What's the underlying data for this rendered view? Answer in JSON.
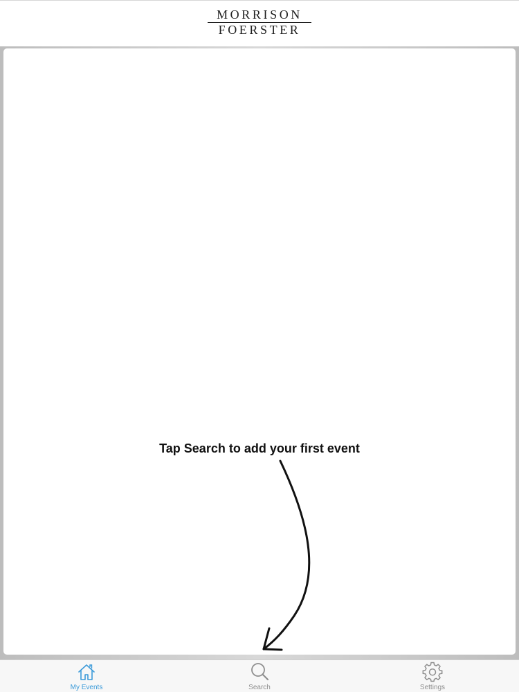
{
  "header": {
    "logo_line1": "MORRISON",
    "logo_line2": "FOERSTER"
  },
  "main": {
    "hint_text": "Tap Search to add your first event"
  },
  "tabbar": {
    "tabs": [
      {
        "label": "My Events",
        "icon": "home-icon",
        "active": true
      },
      {
        "label": "Search",
        "icon": "search-icon",
        "active": false
      },
      {
        "label": "Settings",
        "icon": "gear-icon",
        "active": false
      }
    ]
  },
  "colors": {
    "active_tab": "#3a9ad9",
    "inactive_tab": "#8e8e8e",
    "hint_text": "#111111",
    "frame": "#c8c8c8"
  }
}
